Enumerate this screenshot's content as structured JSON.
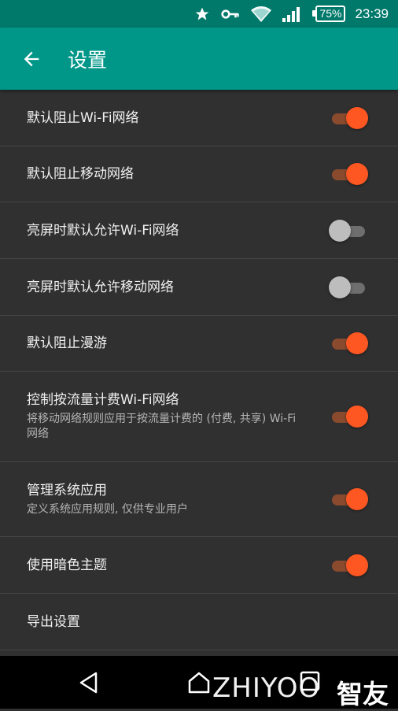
{
  "status_bar": {
    "icons": [
      "star-icon",
      "key-icon",
      "wifi-icon",
      "signal-icon"
    ],
    "battery": "75%",
    "time": "23:39"
  },
  "app_bar": {
    "back_icon": "arrow-left-icon",
    "title": "设置"
  },
  "settings": [
    {
      "title": "默认阻止Wi-Fi网络",
      "subtitle": "",
      "on": true
    },
    {
      "title": "默认阻止移动网络",
      "subtitle": "",
      "on": true
    },
    {
      "title": "亮屏时默认允许Wi-Fi网络",
      "subtitle": "",
      "on": false
    },
    {
      "title": "亮屏时默认允许移动网络",
      "subtitle": "",
      "on": false
    },
    {
      "title": "默认阻止漫游",
      "subtitle": "",
      "on": true
    },
    {
      "title": "控制按流量计费Wi-Fi网络",
      "subtitle": "将移动网络规则应用于按流量计费的 (付费, 共享) Wi-Fi网络",
      "on": true
    },
    {
      "title": "管理系统应用",
      "subtitle": "定义系统应用规则, 仅供专业用户",
      "on": true
    },
    {
      "title": "使用暗色主题",
      "subtitle": "",
      "on": true
    },
    {
      "title": "导出设置",
      "subtitle": ""
    }
  ],
  "nav_bar": {
    "icons": [
      "back-triangle-icon",
      "home-icon",
      "recent-apps-icon"
    ]
  },
  "watermark": {
    "latin": "ZHIYOO",
    "chinese": "智友"
  },
  "colors": {
    "status_bar": "#00796b",
    "app_bar": "#009688",
    "background": "#303030",
    "switch_on": "#ff5722",
    "switch_off": "#bdbdbd"
  }
}
